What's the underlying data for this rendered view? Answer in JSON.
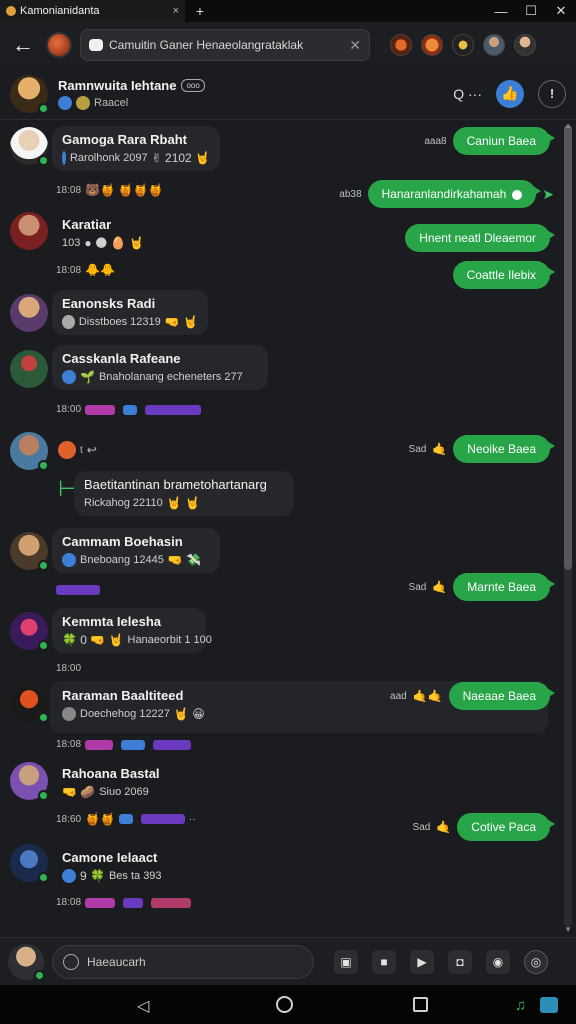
{
  "window": {
    "tab_title": "Kamonianidanta",
    "tab_close": "×",
    "new_tab": "+",
    "minimize": "—",
    "maximize": "☐",
    "close": "✕"
  },
  "topbar": {
    "back": "←",
    "search_text": "Camuitin Ganer Henaeolangrataklak",
    "search_clear": "✕"
  },
  "header": {
    "name": "Ramnwuita Iehtane",
    "badge": "ooo",
    "subtitle": "Raacel",
    "search_glyph": "Q ···",
    "like_glyph": "👍",
    "info_glyph": "!"
  },
  "messages_in": [
    {
      "name": "Gamoga Rara Rbaht",
      "line": "Rarolhonk 2097",
      "line_emoji": "✌ 2102 🤘",
      "time": "18:08",
      "reactions": "🐻🍯 🍯🍯🍯"
    },
    {
      "name": "Karatiar",
      "line": "103",
      "line_emoji": "● 🌑 🥚 🤘",
      "time": "18:08",
      "reactions": "🐥🐥"
    },
    {
      "name": "Eanonsks Radi",
      "line": "Disstboes 12319",
      "line_emoji": "🤜 🤘",
      "time": "",
      "reactions": ""
    },
    {
      "name": "Casskanla Rafeane",
      "line": "Bnaholanang echeneters 277",
      "line_emoji": "🌱",
      "time": "18:00",
      "reactions": ""
    },
    {
      "name": "Baetitantinan brametohartanarg",
      "line": "Rickahog 22110",
      "line_emoji": "🤘 🤘",
      "time": "",
      "reactions": ""
    },
    {
      "name": "Cammam Boehasin",
      "line": "Bneboang 12445",
      "line_emoji": "🤜 💸",
      "time": "",
      "reactions": ""
    },
    {
      "name": "Kemmta Ielesha",
      "line": "Hanaeorbit 1 100",
      "line_emoji": "🍀 0 🤜 🤘",
      "time": "18:00",
      "reactions": ""
    },
    {
      "name": "Raraman Baaltiteed",
      "line": "Doechehog 12227",
      "line_emoji": "🤘 😀",
      "time": "18:08",
      "reactions": ""
    },
    {
      "name": "Rahoana Bastal",
      "line": "Siuo 2069",
      "line_emoji": "🤜 🥔",
      "time": "18:60",
      "reactions": ""
    },
    {
      "name": "Camone Ielaact",
      "line": "Bes ta 393",
      "line_emoji": "9 🍀",
      "time": "18:08",
      "reactions": ""
    }
  ],
  "messages_out": [
    {
      "time": "aaa8",
      "text": "Caniun Baea"
    },
    {
      "time": "ab38",
      "text": "Hanaranlandirkahamah"
    },
    {
      "time": "",
      "text": "Hnent neatl Dleaemor"
    },
    {
      "time": "",
      "text": "Coattle Ilebix"
    },
    {
      "time": "Sad",
      "text": "Neoike Baea"
    },
    {
      "time": "Sad",
      "text": "Marnte Baea"
    },
    {
      "time": "aad",
      "text": "Naeaae Baea"
    },
    {
      "time": "Sad",
      "text": "Cotive Paca"
    }
  ],
  "misc": {
    "reply_marker": "t",
    "extra_dots": "··"
  },
  "composer": {
    "placeholder": "Haeaucarh"
  },
  "colors": {
    "bg": "#1b1c1f",
    "bubble_out": "#27a548",
    "bubble_in": "#26272b",
    "online": "#2fb552",
    "accent_blue": "#3d7fd6"
  }
}
